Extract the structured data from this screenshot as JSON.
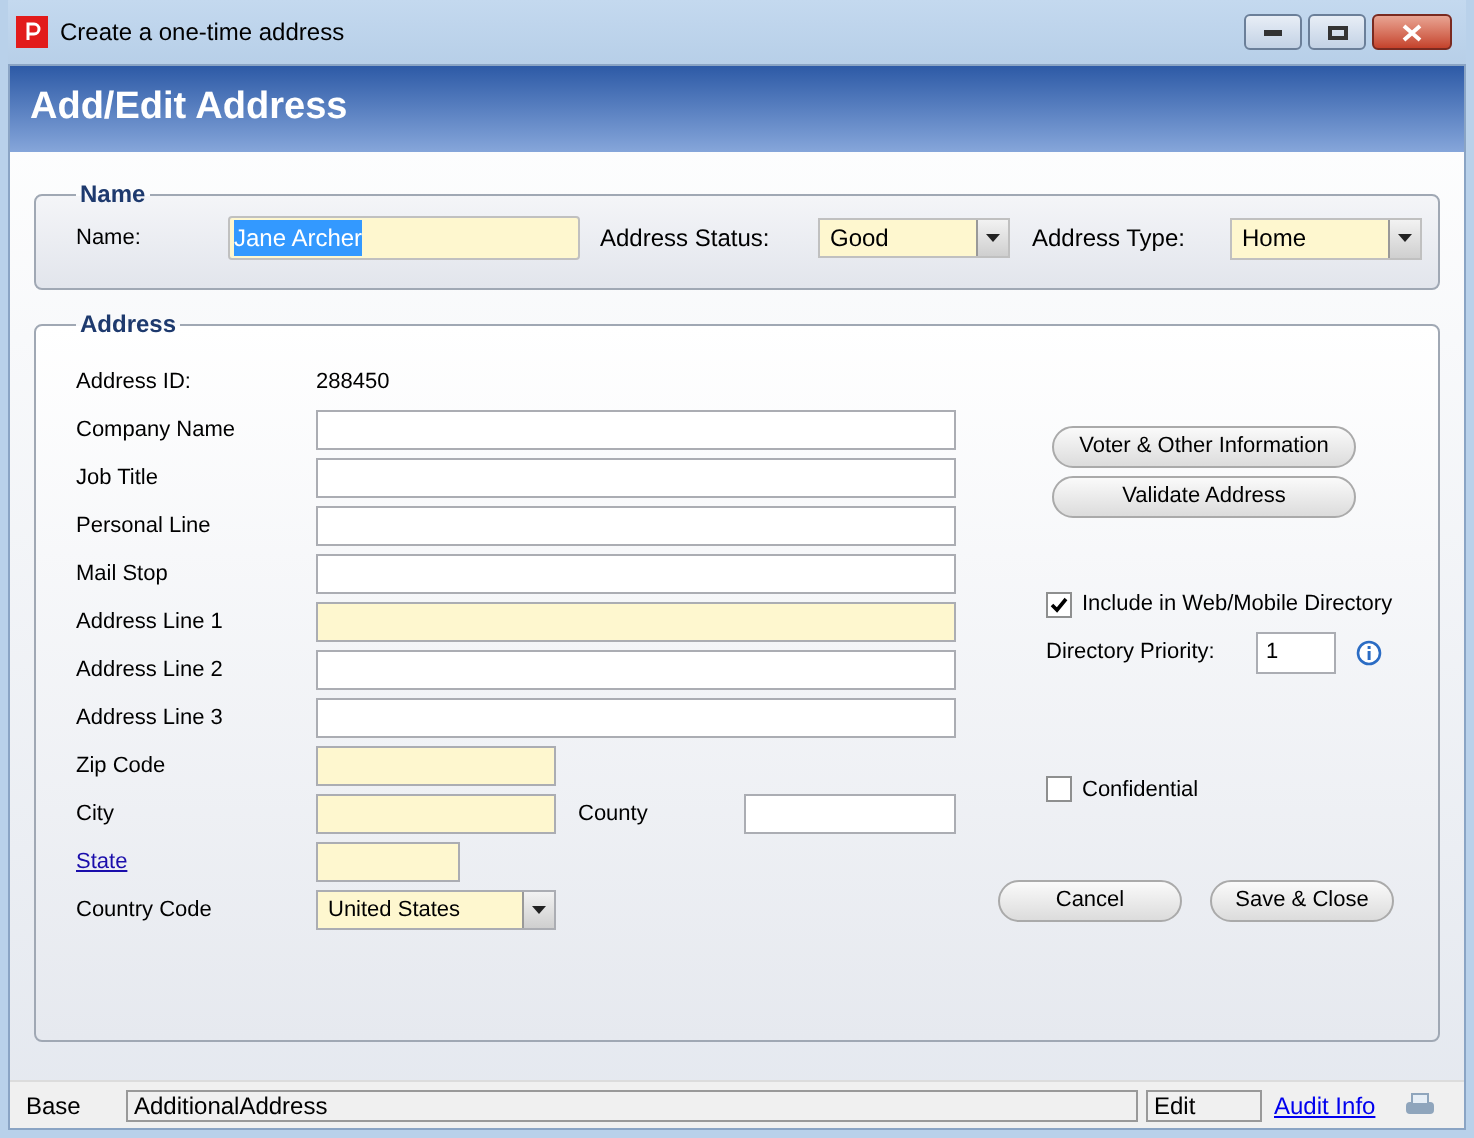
{
  "window": {
    "title": "Create a one-time address"
  },
  "header": {
    "title": "Add/Edit Address"
  },
  "name_group": {
    "legend": "Name",
    "name_label": "Name:",
    "name_value": "Jane Archer",
    "name_selected": true,
    "status_label": "Address Status:",
    "status_value": "Good",
    "type_label": "Address Type:",
    "type_value": "Home"
  },
  "address_group": {
    "legend": "Address",
    "id_label": "Address ID:",
    "id_value": "288450",
    "fields": [
      {
        "label": "Company Name",
        "kind": "text",
        "required": false,
        "link": false
      },
      {
        "label": "Job Title",
        "kind": "text",
        "required": false,
        "link": false
      },
      {
        "label": "Personal Line",
        "kind": "text",
        "required": false,
        "link": false
      },
      {
        "label": "Mail Stop",
        "kind": "text",
        "required": false,
        "link": false
      },
      {
        "label": "Address Line 1",
        "kind": "text",
        "required": true,
        "link": false
      },
      {
        "label": "Address Line 2",
        "kind": "text",
        "required": false,
        "link": false
      },
      {
        "label": "Address Line 3",
        "kind": "text",
        "required": false,
        "link": false
      },
      {
        "label": "Zip Code",
        "kind": "short",
        "required": true,
        "link": false
      },
      {
        "label": "City",
        "kind": "short",
        "required": true,
        "link": false,
        "extra_label": "County"
      },
      {
        "label": "State",
        "kind": "tiny",
        "required": true,
        "link": true
      },
      {
        "label": "Country Code",
        "kind": "dropdown",
        "required": true,
        "link": false,
        "value": "United States"
      }
    ],
    "buttons": [
      "Voter & Other Information",
      "Validate Address"
    ],
    "include_directory": {
      "label": "Include in Web/Mobile Directory",
      "checked": true
    },
    "priority": {
      "label": "Directory Priority:",
      "value": "1"
    },
    "confidential": {
      "label": "Confidential",
      "checked": false
    },
    "actions": [
      "Cancel",
      "Save & Close"
    ]
  },
  "status_bar": {
    "mode": "Base",
    "record": "AdditionalAddress",
    "state": "Edit",
    "link": "Audit Info"
  }
}
